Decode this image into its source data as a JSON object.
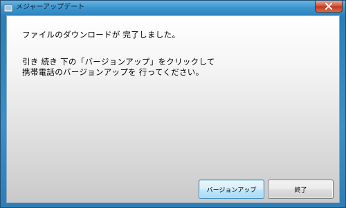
{
  "window": {
    "title": "メジャーアップデート"
  },
  "message": {
    "line1": "ファイルのダウンロードが 完了しました。",
    "line2": "引き 続き 下の「バージョンアップ」をクリックして",
    "line3": "携帯電話のバージョンアップを 行ってください。"
  },
  "buttons": {
    "upgrade_label": "バージョンアップ",
    "exit_label": "終了"
  },
  "icons": {
    "app": "app-icon",
    "close": "close-icon"
  },
  "colors": {
    "titlebar": "#3d95cf",
    "close_button": "#c23a1f",
    "focused_button_border": "#3c7fb1"
  }
}
